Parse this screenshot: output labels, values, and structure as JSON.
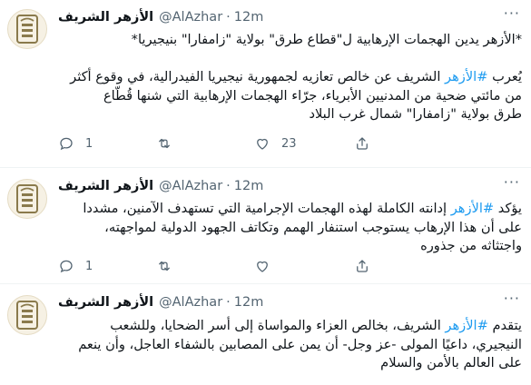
{
  "tweets": [
    {
      "author_name": "الأزهر الشريف",
      "handle": "@AlAzhar",
      "separator": "·",
      "time": "12m",
      "lines": [
        "*الأزهر يدين الهجمات الإرهابية ل\"قطاع طرق\" بولاية \"زامفارا\" بنيجيريا*"
      ],
      "body_lines": [
        "يُعرب #الأزهر الشريف عن خالص تعازيه لجمهورية نيجيريا الفيدرالية، في وقوع أكثر",
        "من مائتي ضحية من المدنيين الأبرياء، جرّاء الهجمات الإرهابية التي شنها قُطّاع",
        "طرق بولاية \"زامفارا\" شمال غرب البلاد"
      ],
      "reply_count": "1",
      "retweet_count": "",
      "like_count": "23"
    },
    {
      "author_name": "الأزهر الشريف",
      "handle": "@AlAzhar",
      "separator": "·",
      "time": "12m",
      "body_lines": [
        "يؤكد #الأزهر إدانته الكاملة لهذه الهجمات الإجرامية التي تستهدف الآمنين، مشددا",
        "على أن هذا الإرهاب يستوجب استنفار الهمم وتكاتف الجهود الدولية لمواجهته،",
        "واجتثاثه من جذوره"
      ],
      "reply_count": "1",
      "retweet_count": "",
      "like_count": ""
    },
    {
      "author_name": "الأزهر الشريف",
      "handle": "@AlAzhar",
      "separator": "·",
      "time": "12m",
      "body_lines": [
        "يتقدم #الأزهر الشريف، بخالص العزاء والمواساة إلى أسر الضحايا، وللشعب",
        "النيجيري، داعيًا المولى -عز وجل- أن يمن على المصابين بالشفاء العاجل، وأن ينعم",
        "على العالم بالأمن والسلام"
      ]
    }
  ],
  "more_label": "···",
  "colors": {
    "link": "#1d9bf0",
    "muted": "#536471",
    "text": "#0f1419"
  }
}
